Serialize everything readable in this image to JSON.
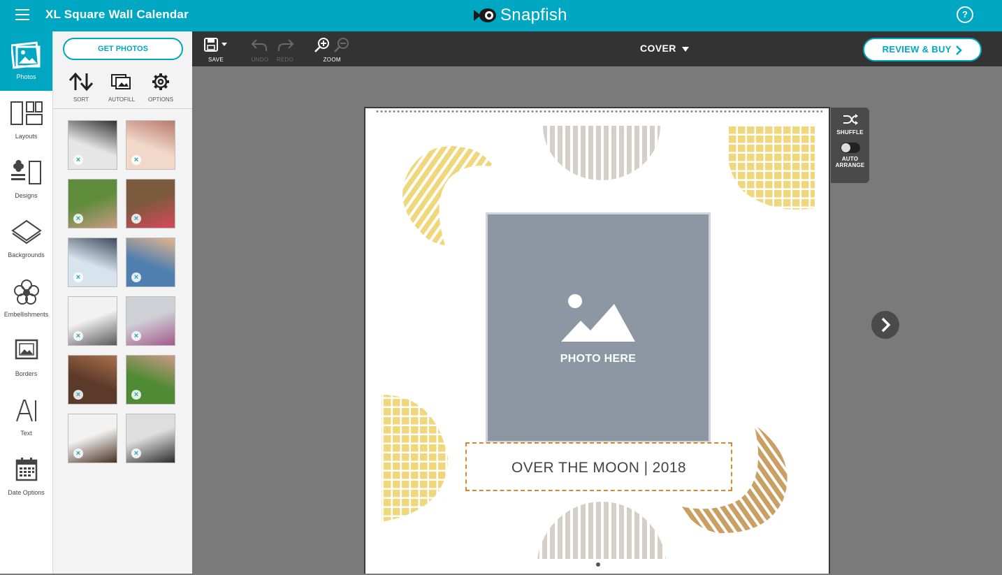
{
  "app": {
    "title": "XL Square Wall Calendar",
    "brand": "Snapfish",
    "help_symbol": "?"
  },
  "colors": {
    "accent": "#00a7c2",
    "toolbar": "#333333",
    "canvas": "#7a7a7a",
    "photo_placeholder": "#8d97a3",
    "yellow": "#f0d77b",
    "beige": "#d6cfc7",
    "gold": "#c9a062",
    "title_border": "#d28a2a"
  },
  "rail": {
    "items": [
      {
        "label": "Photos",
        "icon": "photos-icon",
        "active": true
      },
      {
        "label": "Layouts",
        "icon": "layouts-icon"
      },
      {
        "label": "Designs",
        "icon": "designs-icon"
      },
      {
        "label": "Backgrounds",
        "icon": "backgrounds-icon"
      },
      {
        "label": "Embellishments",
        "icon": "embellishments-icon"
      },
      {
        "label": "Borders",
        "icon": "borders-icon"
      },
      {
        "label": "Text",
        "icon": "text-icon"
      },
      {
        "label": "Date Options",
        "icon": "date-options-icon"
      }
    ]
  },
  "panel": {
    "get_photos": "GET PHOTOS",
    "tools": [
      {
        "label": "SORT",
        "icon": "sort-icon"
      },
      {
        "label": "AUTOFILL",
        "icon": "autofill-icon"
      },
      {
        "label": "OPTIONS",
        "icon": "gear-icon"
      }
    ],
    "remove_symbol": "×",
    "thumbnails": [
      {
        "subject": "dog on bench",
        "palette": [
          "#e6e6e6",
          "#333333"
        ]
      },
      {
        "subject": "girl smiling",
        "palette": [
          "#f1d8c9",
          "#b77a6c"
        ]
      },
      {
        "subject": "woman in garden",
        "palette": [
          "#5e8c3a",
          "#c99a86"
        ]
      },
      {
        "subject": "child in playground",
        "palette": [
          "#7c5a3e",
          "#d9485a"
        ]
      },
      {
        "subject": "couple by water",
        "palette": [
          "#d7e4ee",
          "#3d4a5c"
        ]
      },
      {
        "subject": "couple selfie",
        "palette": [
          "#4f7fae",
          "#e2b58f"
        ]
      },
      {
        "subject": "woman with scarf",
        "palette": [
          "#f2f2f2",
          "#5a5a5a"
        ]
      },
      {
        "subject": "girls hugging",
        "palette": [
          "#cfcfd6",
          "#a35a8a"
        ]
      },
      {
        "subject": "leaves",
        "palette": [
          "#5b3a2a",
          "#a9704a"
        ]
      },
      {
        "subject": "woman in garden",
        "palette": [
          "#4f8a34",
          "#c99a86"
        ]
      },
      {
        "subject": "puppy",
        "palette": [
          "#f2f2f2",
          "#4a3020"
        ]
      },
      {
        "subject": "kiss portrait",
        "palette": [
          "#dedede",
          "#2c2c2c"
        ]
      }
    ]
  },
  "toolbar": {
    "save": "SAVE",
    "undo": "UNDO",
    "redo": "REDO",
    "zoom": "ZOOM",
    "page_select": "COVER",
    "review_buy": "REVIEW & BUY"
  },
  "canvas": {
    "photo_placeholder": "PHOTO HERE",
    "title_text": "OVER THE MOON | 2018"
  },
  "side_tools": {
    "shuffle": "SHUFFLE",
    "auto_line1": "AUTO",
    "auto_line2": "ARRANGE",
    "auto_arrange_on": false
  }
}
